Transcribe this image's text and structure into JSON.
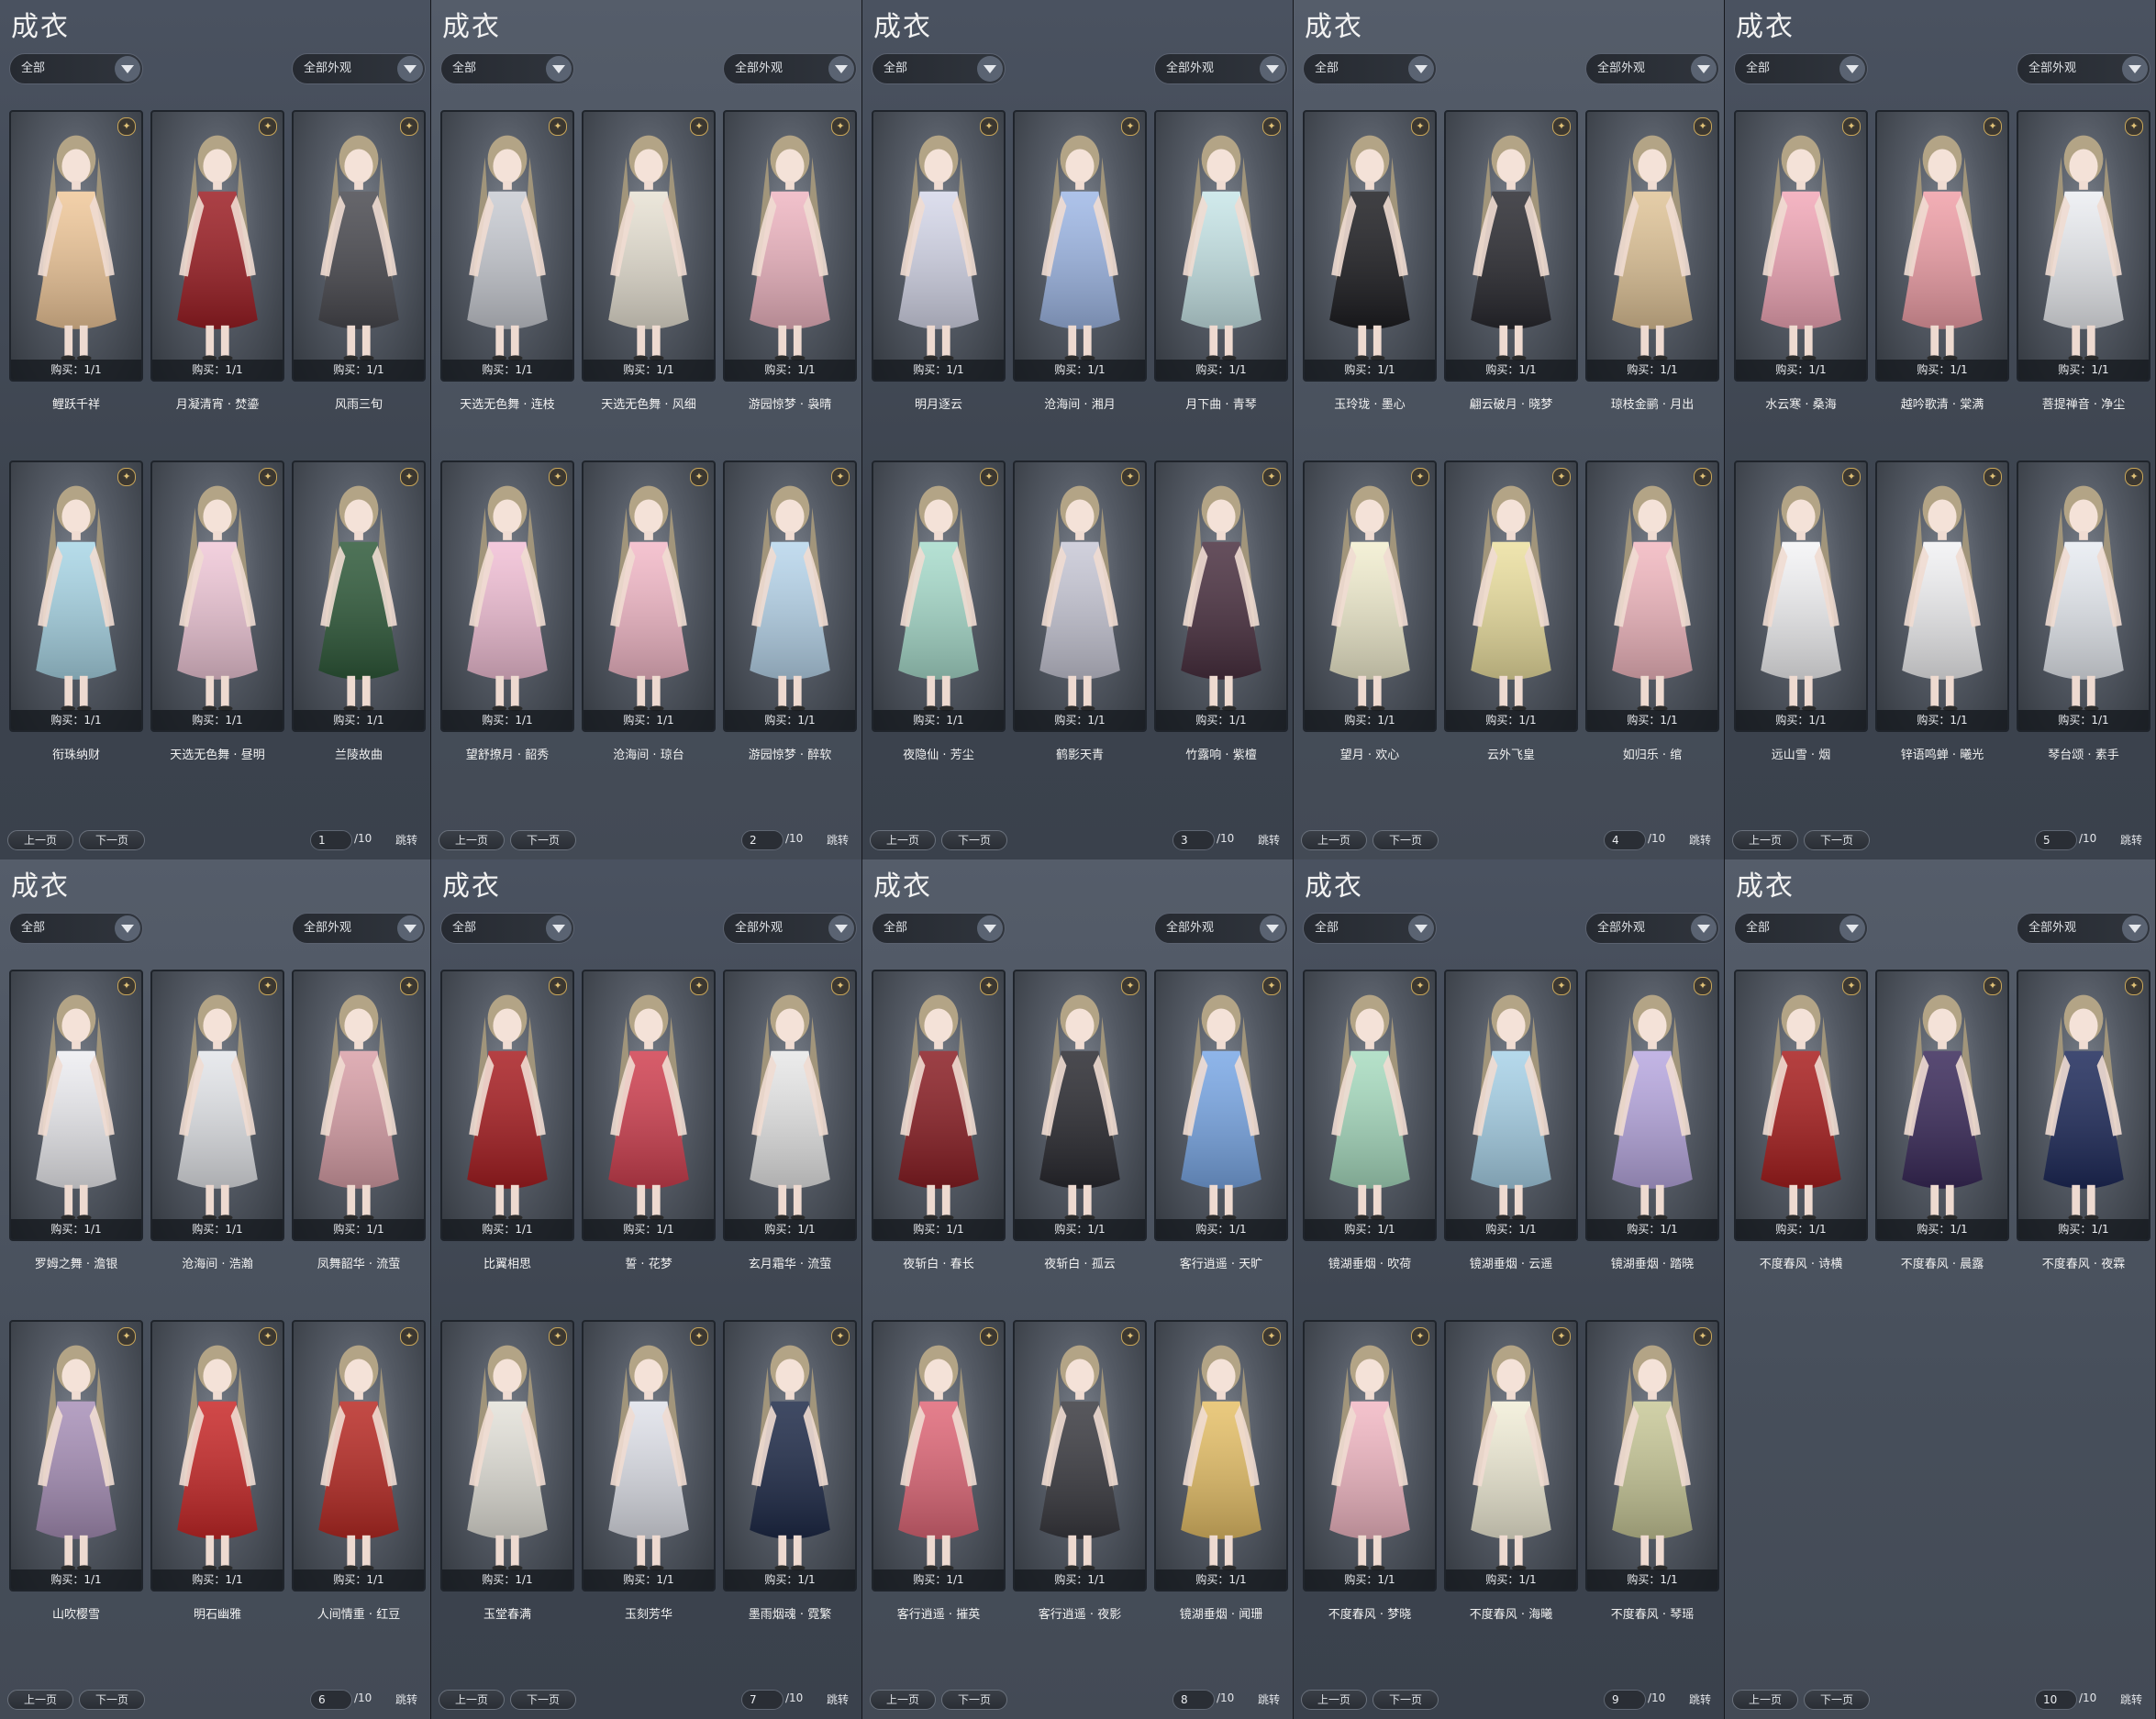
{
  "common": {
    "title": "成衣",
    "category_filter": "全部",
    "look_filter": "全部外观",
    "prev_label": "上一页",
    "next_label": "下一页",
    "go_label": "跳转",
    "total_pages": "/10",
    "buy_label": "购买：1/1"
  },
  "panels": [
    {
      "page": "1",
      "items": [
        "鲤跃千祥",
        "月凝清宵 · 焚鎏",
        "风雨三旬",
        "衔珠纳财",
        "天选无色舞 · 昼明",
        "兰陵故曲"
      ]
    },
    {
      "page": "2",
      "items": [
        "天选无色舞 · 连枝",
        "天选无色舞 · 风细",
        "游园惊梦 · 袅晴",
        "望舒撩月 · 韶秀",
        "沧海间 · 琼台",
        "游园惊梦 · 醉软"
      ]
    },
    {
      "page": "3",
      "items": [
        "明月逐云",
        "沧海间 · 湘月",
        "月下曲 · 青琴",
        "夜隐仙 · 芳尘",
        "鹤影天青",
        "竹露响 · 紫檀"
      ]
    },
    {
      "page": "4",
      "items": [
        "玉玲珑 · 墨心",
        "翩云破月 · 晓梦",
        "琼枝金鹂 · 月出",
        "望月 · 欢心",
        "云外飞皇",
        "如归乐 · 绾"
      ]
    },
    {
      "page": "5",
      "items": [
        "水云寒 · 桑海",
        "越吟歌清 · 棠满",
        "菩提禅音 · 净尘",
        "远山雪 · 烟",
        "锌语鸣蝉 · 曦光",
        "琴台颂 · 素手"
      ]
    },
    {
      "page": "6",
      "items": [
        "罗姆之舞 · 澹银",
        "沧海间 · 浩瀚",
        "凤舞韶华 · 流萤",
        "山吹樱雪",
        "明石幽雅",
        "人间情重 · 红豆"
      ]
    },
    {
      "page": "7",
      "items": [
        "比翼相思",
        "誓 · 花梦",
        "玄月霜华 · 流萤",
        "玉堂春满",
        "玉刻芳华",
        "墨雨烟魂 · 霓繁"
      ]
    },
    {
      "page": "8",
      "items": [
        "夜斩白 · 春长",
        "夜斩白 · 孤云",
        "客行逍遥 · 天旷",
        "客行逍遥 · 摧英",
        "客行逍遥 · 夜影",
        "镜湖垂烟 · 闻珊"
      ]
    },
    {
      "page": "9",
      "items": [
        "镜湖垂烟 · 吹荷",
        "镜湖垂烟 · 云遥",
        "镜湖垂烟 · 踏晓",
        "不度春风 · 梦晓",
        "不度春风 · 海曦",
        "不度春风 · 琴瑶"
      ]
    },
    {
      "page": "10",
      "items": [
        "不度春风 · 诗横",
        "不度春风 · 晨露",
        "不度春风 · 夜霖"
      ]
    }
  ],
  "outfit_colors": [
    [
      "#f0c89a",
      "#9c1e24",
      "#4a4a50",
      "#a9d6e6",
      "#f0c8d8",
      "#2f5a3a"
    ],
    [
      "#c9ccd3",
      "#e8e2d4",
      "#efb6c2",
      "#f2c0d6",
      "#f3b9c8",
      "#b8d6ec"
    ],
    [
      "#d6d8ea",
      "#9fb8e6",
      "#c8e6e8",
      "#a8dccc",
      "#c8c8d6",
      "#4a3040"
    ],
    [
      "#1e1e22",
      "#2a2a30",
      "#e0c498",
      "#f2eed0",
      "#ece0a0",
      "#f2b8c0"
    ],
    [
      "#f2a8b8",
      "#f0a0a8",
      "#eceef2",
      "#f4f4f6",
      "#f2f2f4",
      "#e8ecf2"
    ],
    [
      "#eeeef2",
      "#e4e6ea",
      "#d9a0a8",
      "#a890b8",
      "#c82828",
      "#b82a24"
    ],
    [
      "#a81e22",
      "#d04050",
      "#e8e8e8",
      "#e4e2da",
      "#e0e2ea",
      "#1e2a48"
    ],
    [
      "#8a1e24",
      "#2a2a30",
      "#7aa8e6",
      "#e06878",
      "#3a3a40",
      "#e6c068"
    ],
    [
      "#a8dcc0",
      "#a8d2e8",
      "#b8a8e0",
      "#f2b8c4",
      "#f2eed8",
      "#c8c898"
    ],
    [
      "#a81e1e",
      "#3a2a5a",
      "#1e2a5a"
    ]
  ]
}
